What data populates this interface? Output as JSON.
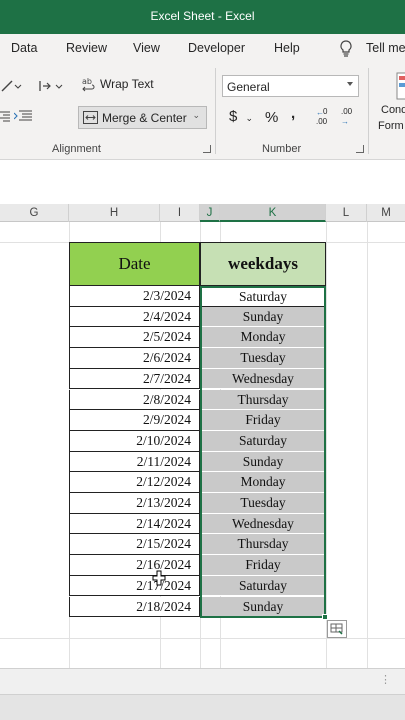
{
  "window": {
    "title": "Excel Sheet  -  Excel"
  },
  "menu": {
    "items": [
      "Data",
      "Review",
      "View",
      "Developer",
      "Help"
    ],
    "tell_me": "Tell me"
  },
  "ribbon": {
    "wrap_text": "Wrap Text",
    "merge_center": "Merge & Center",
    "number_format": "General",
    "currency_symbol": "$",
    "percent_symbol": "%",
    "comma_symbol": ",",
    "increase_decimal": ".00",
    "decrease_decimal": ".00",
    "conditional_line1": "Cond",
    "conditional_line2": "Form",
    "groups": {
      "alignment": "Alignment",
      "number": "Number"
    }
  },
  "columns": [
    "G",
    "H",
    "I",
    "J",
    "K",
    "L",
    "M"
  ],
  "table": {
    "headers": {
      "date": "Date",
      "weekdays": "weekdays"
    },
    "rows": [
      {
        "date": "2/3/2024",
        "weekday": "Saturday"
      },
      {
        "date": "2/4/2024",
        "weekday": "Sunday"
      },
      {
        "date": "2/5/2024",
        "weekday": "Monday"
      },
      {
        "date": "2/6/2024",
        "weekday": "Tuesday"
      },
      {
        "date": "2/7/2024",
        "weekday": "Wednesday"
      },
      {
        "date": "2/8/2024",
        "weekday": "Thursday"
      },
      {
        "date": "2/9/2024",
        "weekday": "Friday"
      },
      {
        "date": "2/10/2024",
        "weekday": "Saturday"
      },
      {
        "date": "2/11/2024",
        "weekday": "Sunday"
      },
      {
        "date": "2/12/2024",
        "weekday": "Monday"
      },
      {
        "date": "2/13/2024",
        "weekday": "Tuesday"
      },
      {
        "date": "2/14/2024",
        "weekday": "Wednesday"
      },
      {
        "date": "2/15/2024",
        "weekday": "Thursday"
      },
      {
        "date": "2/16/2024",
        "weekday": "Friday"
      },
      {
        "date": "2/17/2024",
        "weekday": "Saturday"
      },
      {
        "date": "2/18/2024",
        "weekday": "Sunday"
      }
    ]
  },
  "colors": {
    "excel_green": "#1e7145",
    "date_header_fill": "#92d050",
    "weekday_header_fill": "#c6e0b4",
    "selection_fill": "#c9c9c9"
  }
}
